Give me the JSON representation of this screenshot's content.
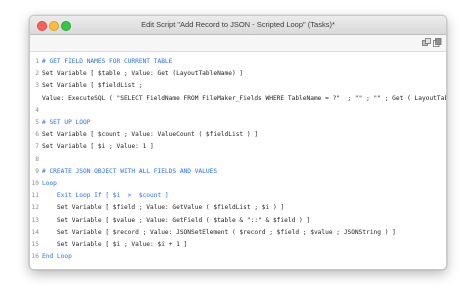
{
  "window": {
    "title": "Edit Script \"Add Record to JSON - Scripted Loop\" (Tasks)*"
  },
  "toolbar": {
    "icons": [
      "layers-icon",
      "copy-icon"
    ]
  },
  "colors": {
    "comment": "#2a6df0",
    "text": "#222222",
    "line_number": "#8a8a8a"
  },
  "script": {
    "lines": [
      {
        "num": "1",
        "text": "# GET FIELD NAMES FOR CURRENT TABLE",
        "kind": "comment"
      },
      {
        "num": "2",
        "text": "Set Variable [ $table ; Value: Get (LayoutTableName) ]",
        "kind": "step"
      },
      {
        "num": "3",
        "text": "Set Variable [ $fieldList ;",
        "kind": "step"
      },
      {
        "num": "",
        "text": "Value: ExecuteSQL ( \"SELECT FieldName FROM FileMaker_Fields WHERE TableName = ?\"  ; \"\" ; \"\" ; Get ( LayoutTableName ) ) ]",
        "kind": "step"
      },
      {
        "num": "4",
        "text": "",
        "kind": "blank"
      },
      {
        "num": "5",
        "text": "# SET UP LOOP",
        "kind": "comment"
      },
      {
        "num": "6",
        "text": "Set Variable [ $count ; Value: ValueCount ( $fieldList ) ]",
        "kind": "step"
      },
      {
        "num": "7",
        "text": "Set Variable [ $i ; Value: 1 ]",
        "kind": "step"
      },
      {
        "num": "8",
        "text": "",
        "kind": "blank"
      },
      {
        "num": "9",
        "text": "# CREATE JSON OBJECT WITH ALL FIELDS AND VALUES",
        "kind": "comment"
      },
      {
        "num": "10",
        "text": "Loop",
        "kind": "control"
      },
      {
        "num": "11",
        "text": "    Exit Loop If [ $i  >  $count ]",
        "kind": "control"
      },
      {
        "num": "12",
        "text": "    Set Variable [ $field ; Value: GetValue ( $fieldList ; $i ) ]",
        "kind": "step"
      },
      {
        "num": "13",
        "text": "    Set Variable [ $value ; Value: GetField ( $table & \"::\" & $field ) ]",
        "kind": "step"
      },
      {
        "num": "14",
        "text": "    Set Variable [ $record ; Value: JSONSetElement ( $record ; $field ; $value ; JSONString ) ]",
        "kind": "step"
      },
      {
        "num": "15",
        "text": "    Set Variable [ $i ; Value: $i + 1 ]",
        "kind": "step"
      },
      {
        "num": "16",
        "text": "End Loop",
        "kind": "control"
      }
    ]
  }
}
